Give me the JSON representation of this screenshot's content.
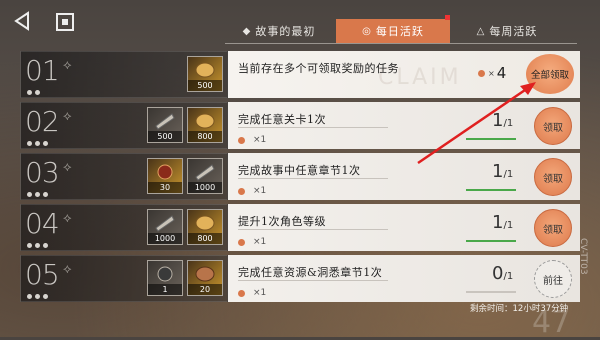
{
  "tabs": [
    {
      "icon": "◆",
      "label": "故事的最初",
      "active": false
    },
    {
      "icon": "◎",
      "label": "每日活跃",
      "active": true
    },
    {
      "icon": "△",
      "label": "每周活跃",
      "active": false
    }
  ],
  "colors": {
    "accent": "#d9784b",
    "progress_done": "#4aa84a"
  },
  "claim_all": {
    "num": "01",
    "reward_qty": "500",
    "title": "当前存在多个可领取奖励的任务",
    "count_x": "×",
    "count": "4",
    "button": "全部领取",
    "watermark": "CLAIM"
  },
  "tasks": [
    {
      "num": "02",
      "title": "完成任意关卡1次",
      "reward_x": "×1",
      "done": "1",
      "total": "1",
      "progress": 1.0,
      "button": "领取",
      "rewards": [
        {
          "qty": "500",
          "icon": "ticket-icon"
        },
        {
          "qty": "800",
          "icon": "coin-icon"
        }
      ]
    },
    {
      "num": "03",
      "title": "完成故事中任意章节1次",
      "reward_x": "×1",
      "done": "1",
      "total": "1",
      "progress": 1.0,
      "button": "领取",
      "rewards": [
        {
          "qty": "30",
          "icon": "gem-icon"
        },
        {
          "qty": "1000",
          "icon": "ticket-icon"
        }
      ]
    },
    {
      "num": "04",
      "title": "提升1次角色等级",
      "reward_x": "×1",
      "done": "1",
      "total": "1",
      "progress": 1.0,
      "button": "领取",
      "rewards": [
        {
          "qty": "1000",
          "icon": "ticket-icon"
        },
        {
          "qty": "800",
          "icon": "coin-icon"
        }
      ]
    },
    {
      "num": "05",
      "title": "完成任意资源&洞悉章节1次",
      "reward_x": "×1",
      "done": "0",
      "total": "1",
      "progress": 0.0,
      "button": "前往",
      "rewards": [
        {
          "qty": "1",
          "icon": "crest-icon"
        },
        {
          "qty": "20",
          "icon": "coin-icon"
        }
      ]
    }
  ],
  "timer": "剩余时间：12小时37分钟",
  "side_code": "CV-TT03",
  "corner_num": "47"
}
